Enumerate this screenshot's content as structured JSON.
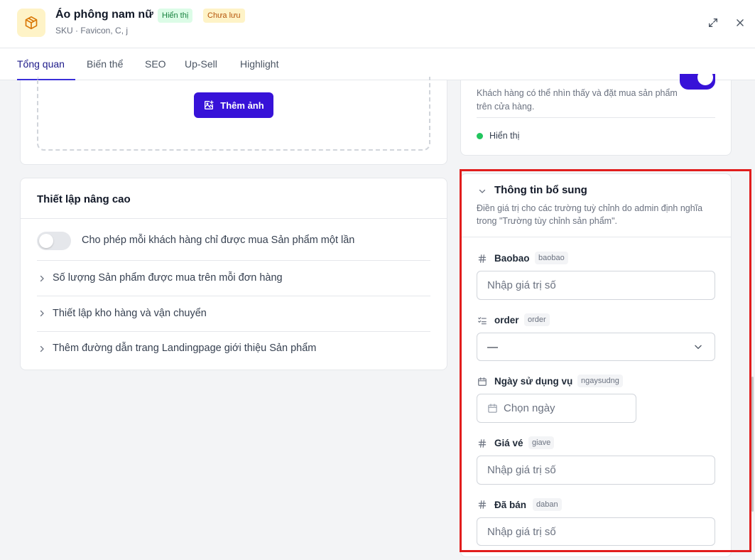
{
  "header": {
    "product_name": "Áo phông nam nữ",
    "status_visible": "Hiển thị",
    "status_unsaved": "Chưa lưu",
    "subtitle": "SKU · Favicon, C, j"
  },
  "tabs": [
    {
      "label": "Tổng quan",
      "active": true
    },
    {
      "label": "Biến thể"
    },
    {
      "label": "SEO"
    },
    {
      "label": "Up-Sell"
    },
    {
      "label": "Highlight"
    }
  ],
  "media": {
    "add_image_label": "Thêm ảnh"
  },
  "advanced": {
    "title": "Thiết lập nâng cao",
    "once_per_customer": "Cho phép mỗi khách hàng chỉ được mua Sản phẩm một lần",
    "once_per_customer_enabled": false,
    "rows": [
      "Số lượng Sản phẩm được mua trên mỗi đơn hàng",
      "Thiết lập kho hàng và vận chuyển",
      "Thêm đường dẫn trang Landingpage giới thiệu Sản phẩm"
    ]
  },
  "visibility": {
    "description": "Khách hàng có thể nhìn thấy và đặt mua sản phẩm trên cửa hàng.",
    "enabled": true,
    "status": "Hiển thị"
  },
  "extra_info": {
    "title": "Thông tin bổ sung",
    "description": "Điền giá trị cho các trường tuỳ chỉnh do admin định nghĩa trong \"Trường tùy chỉnh sản phẩm\".",
    "fields": [
      {
        "label": "Baobao",
        "key": "baobao",
        "icon": "hash-icon",
        "placeholder": "Nhập giá trị số"
      },
      {
        "label": "order",
        "key": "order",
        "icon": "checklist-icon",
        "value": "—"
      },
      {
        "label": "Ngày sử dụng vụ",
        "key": "ngaysudng",
        "icon": "calendar-icon",
        "placeholder": "Chọn ngày"
      },
      {
        "label": "Giá vé",
        "key": "giave",
        "icon": "hash-icon",
        "placeholder": "Nhập giá trị số"
      },
      {
        "label": "Đã bán",
        "key": "daban",
        "icon": "hash-icon",
        "placeholder": "Nhập giá trị số"
      }
    ]
  },
  "colors": {
    "accent": "#3712d8",
    "highlight": "#e11d1d",
    "success": "#22c55e"
  }
}
